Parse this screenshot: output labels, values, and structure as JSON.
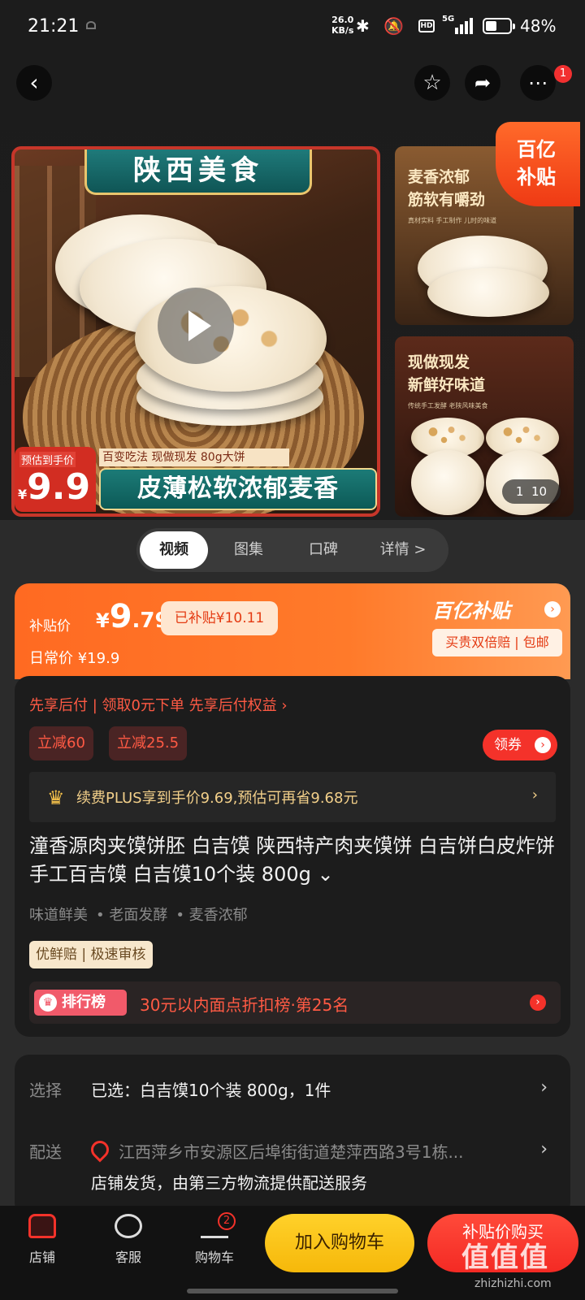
{
  "status_bar": {
    "time": "21:21",
    "net_speed": "26.0",
    "net_unit": "KB/s",
    "signal": "5G",
    "battery_percent": "48%",
    "battery_level": 0.48,
    "icons": [
      "bluetooth-icon",
      "mute-icon",
      "hd-icon",
      "signal-icon",
      "battery-icon"
    ]
  },
  "nav": {
    "back_icon": "back-icon",
    "fav_icon": "star-icon",
    "share_icon": "share-icon",
    "more_icon": "more-icon",
    "more_badge": "1"
  },
  "gallery": {
    "main_banner_top": "陕西美食",
    "price_tag_label": "预估到手价",
    "price_tag_yen": "¥",
    "price_tag_value": "9.9",
    "sub_line": "百变吃法 现做现发 80g大饼",
    "bottom_banner": "皮薄松软浓郁麦香",
    "side1_line1": "麦香浓郁",
    "side1_line2": "筋软有嚼劲",
    "side1_small": "真材实料 手工制作 儿时的味道",
    "side2_line1": "现做现发",
    "side2_line2": "新鲜好味道",
    "side2_small": "传统手工发酵 老陕风味美食",
    "subsidy_a": "百亿",
    "subsidy_b": "补贴",
    "counter_current": "1",
    "counter_total": "10"
  },
  "tabs": [
    {
      "label": "视频",
      "active": true
    },
    {
      "label": "图集",
      "active": false
    },
    {
      "label": "口碑",
      "active": false
    },
    {
      "label": "详情 >",
      "active": false
    }
  ],
  "price_panel": {
    "subsidy_label": "补贴价",
    "yen": "¥",
    "price_int": "9",
    "price_dec": ".79",
    "subsidized": "已补贴¥10.11",
    "daily_label": "日常价",
    "daily_price": "¥19.9",
    "brand": "百亿补贴",
    "perk": "买贵双倍赔 | 包邮"
  },
  "info": {
    "paylater": "先享后付 | 领取0元下单 先享后付权益 ›",
    "chip1": "立减60",
    "chip2": "立减25.5",
    "coupon_btn": "领券",
    "plus_text": "续费PLUS享到手价9.69,预估可再省9.68元",
    "plus_chev": "›",
    "title": "潼香源肉夹馍饼胚 白吉馍 陕西特产肉夹馍饼 白吉饼白皮炸饼 手工百吉馍 白吉馍10个装 800g ⌄",
    "features": [
      "味道鲜美",
      "•  老面发酵",
      "•  麦香浓郁"
    ],
    "service_tags": "优鲜赔 | 极速审核",
    "rank_badge": "排行榜",
    "rank_text": "30元以内面点折扣榜·第25名"
  },
  "select": {
    "choose_label": "选择",
    "choose_value": "已选：白吉馍10个装 800g，1件",
    "ship_label": "配送",
    "address": "江西萍乡市安源区后埠街街道楚萍西路3号1栋...",
    "ship_note": "店铺发货，由第三方物流提供配送服务"
  },
  "bottom": {
    "shop": "店铺",
    "service": "客服",
    "cart": "购物车",
    "cart_count": "2",
    "add_cart": "加入购物车",
    "buy_now": "补贴价购买",
    "watermark": "值值值",
    "watermark_sub": "zhizhizhi.com"
  }
}
